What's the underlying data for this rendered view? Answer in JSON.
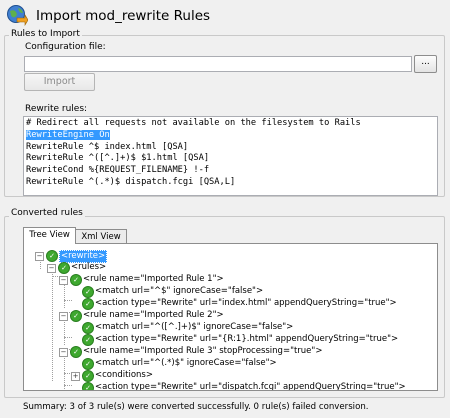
{
  "title": "Import mod_rewrite Rules",
  "rules_to_import": {
    "legend": "Rules to Import",
    "config_label": "Configuration file:",
    "config_value": "",
    "browse_label": "...",
    "import_label": "Import",
    "rewrite_label": "Rewrite rules:",
    "rewrite_lines": [
      "# Redirect all requests not available on the filesystem to Rails",
      "RewriteEngine On",
      "RewriteRule ^$ index.html [QSA]",
      "RewriteRule ^([^.]+)$ $1.html [QSA]",
      "RewriteCond %{REQUEST_FILENAME} !-f",
      "RewriteRule ^(.*)$ dispatch.fcgi [QSA,L]"
    ]
  },
  "converted": {
    "legend": "Converted rules",
    "tabs": [
      "Tree View",
      "Xml View"
    ],
    "tree": [
      "<rewrite>",
      "<rules>",
      "<rule name=\"Imported Rule 1\">",
      "<match url=\"^$\" ignoreCase=\"false\">",
      "<action type=\"Rewrite\" url=\"index.html\" appendQueryString=\"true\">",
      "<rule name=\"Imported Rule 2\">",
      "<match url=\"^([^.]+)$\" ignoreCase=\"false\">",
      "<action type=\"Rewrite\" url=\"{R:1}.html\" appendQueryString=\"true\">",
      "<rule name=\"Imported Rule 3\" stopProcessing=\"true\">",
      "<match url=\"^(.*)$\" ignoreCase=\"false\">",
      "<conditions>",
      "<action type=\"Rewrite\" url=\"dispatch.fcgi\" appendQueryString=\"true\">"
    ]
  },
  "summary": "Summary: 3 of 3 rule(s) were converted successfully. 0 rule(s) failed conversion.",
  "icons": {
    "header": "globe-arrow-icon",
    "node_status": "check-icon",
    "expander_open": "minus-icon",
    "expander_closed": "plus-icon"
  },
  "colors": {
    "selection": "#3399ff",
    "check": "#3ea82f",
    "background": "#f0f0f0"
  }
}
